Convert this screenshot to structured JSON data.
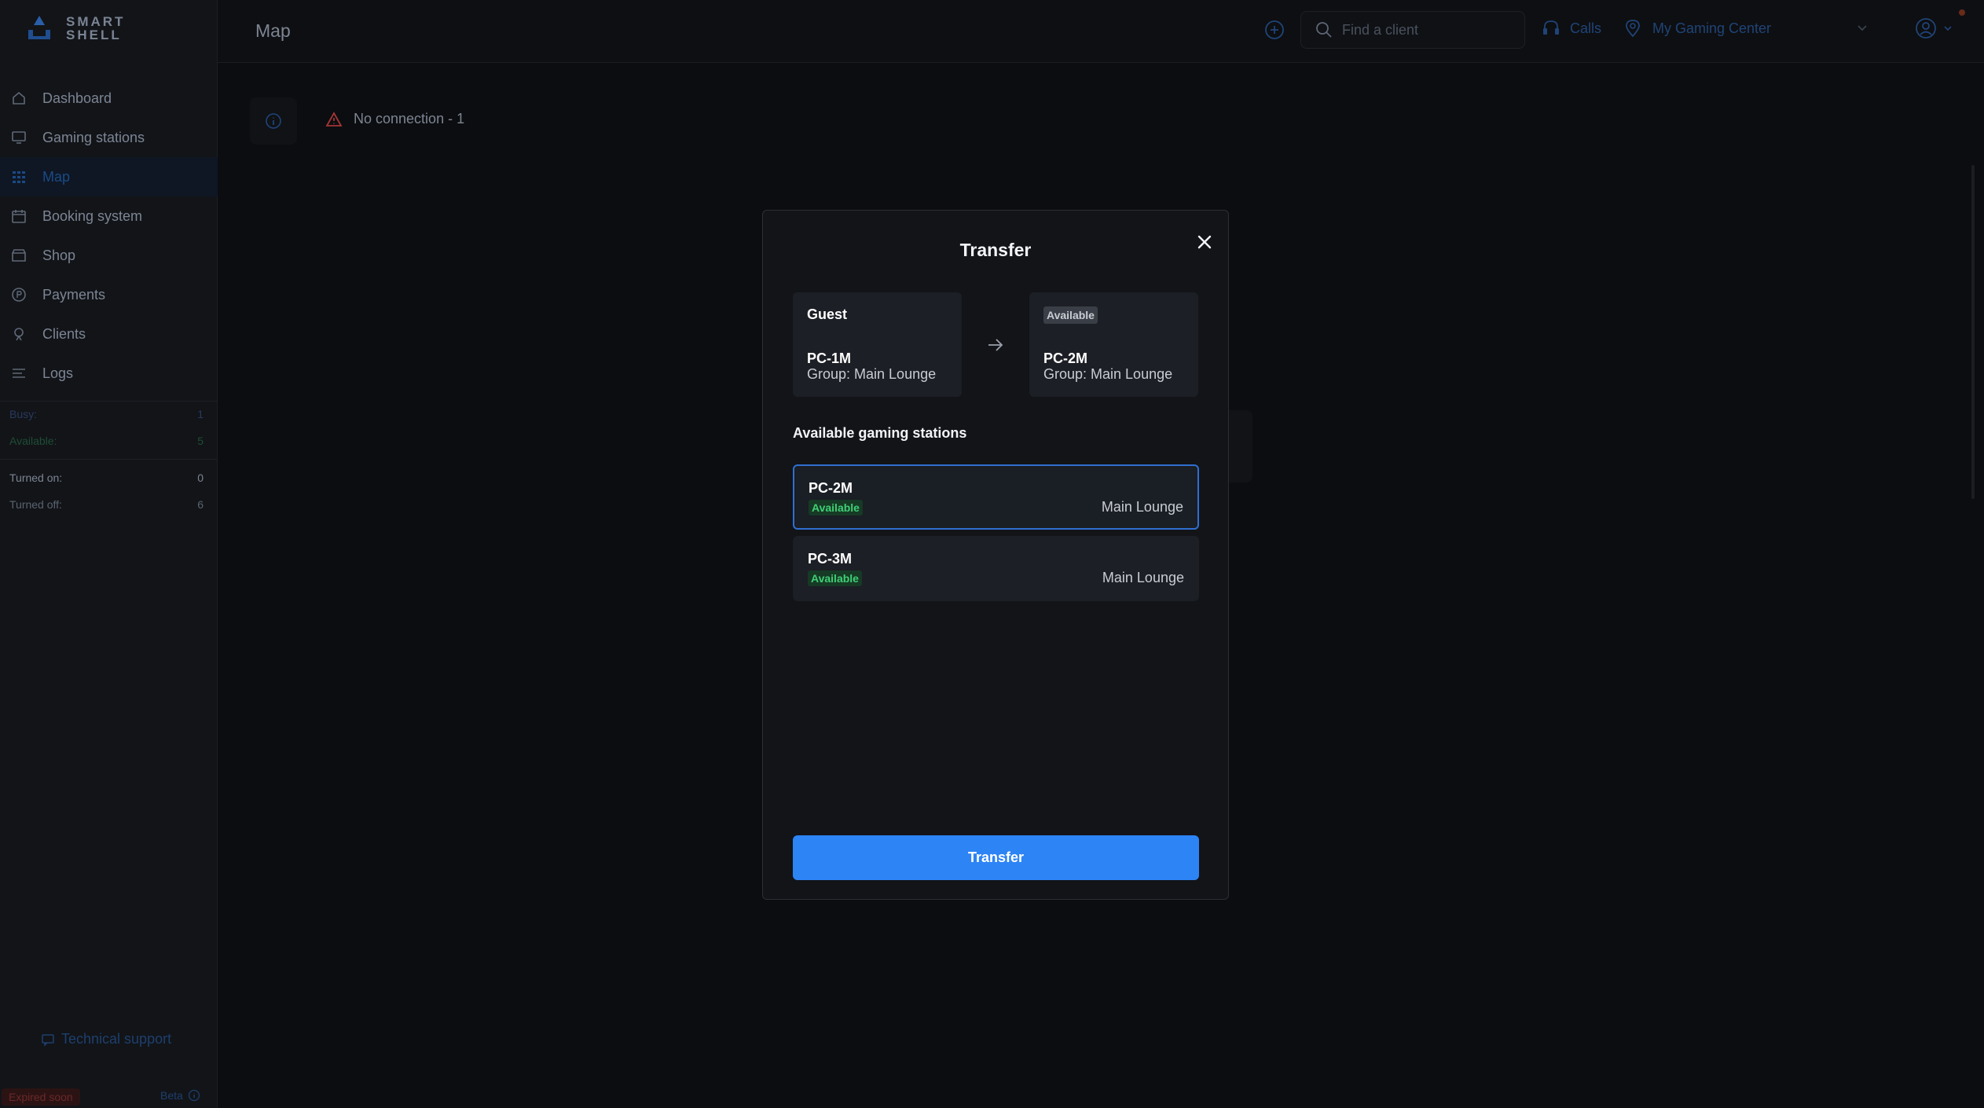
{
  "app": {
    "logo_line1": "SMART",
    "logo_line2": "SHELL"
  },
  "header": {
    "title": "Map",
    "search_placeholder": "Find a client",
    "calls_label": "Calls",
    "center_name": "My Gaming Center"
  },
  "sidebar": {
    "items": [
      {
        "label": "Dashboard",
        "icon": "home-icon"
      },
      {
        "label": "Gaming stations",
        "icon": "monitor-icon"
      },
      {
        "label": "Map",
        "icon": "grid-icon"
      },
      {
        "label": "Booking system",
        "icon": "calendar-icon"
      },
      {
        "label": "Shop",
        "icon": "store-icon"
      },
      {
        "label": "Payments",
        "icon": "coin-icon"
      },
      {
        "label": "Clients",
        "icon": "person-icon"
      },
      {
        "label": "Logs",
        "icon": "list-icon"
      }
    ],
    "stats": {
      "busy_label": "Busy:",
      "busy_value": "1",
      "available_label": "Available:",
      "available_value": "5",
      "turned_on_label": "Turned on:",
      "turned_on_value": "0",
      "turned_off_label": "Turned off:",
      "turned_off_value": "6"
    },
    "support_label": "Technical support",
    "expired_label": "Expired soon",
    "beta_label": "Beta"
  },
  "content": {
    "no_connection": "No connection - 1"
  },
  "modal": {
    "title": "Transfer",
    "from": {
      "heading": "Guest",
      "pc": "PC-1M",
      "group": "Group: Main Lounge"
    },
    "to": {
      "status": "Available",
      "pc": "PC-2M",
      "group": "Group: Main Lounge"
    },
    "section_title": "Available gaming stations",
    "stations": [
      {
        "name": "PC-2M",
        "status": "Available",
        "group": "Main Lounge",
        "selected": true
      },
      {
        "name": "PC-3M",
        "status": "Available",
        "group": "Main Lounge",
        "selected": false
      }
    ],
    "button_label": "Transfer"
  },
  "colors": {
    "accent": "#2d84f5",
    "available_green": "#3fcf75",
    "warning_red": "#b83a3a"
  }
}
